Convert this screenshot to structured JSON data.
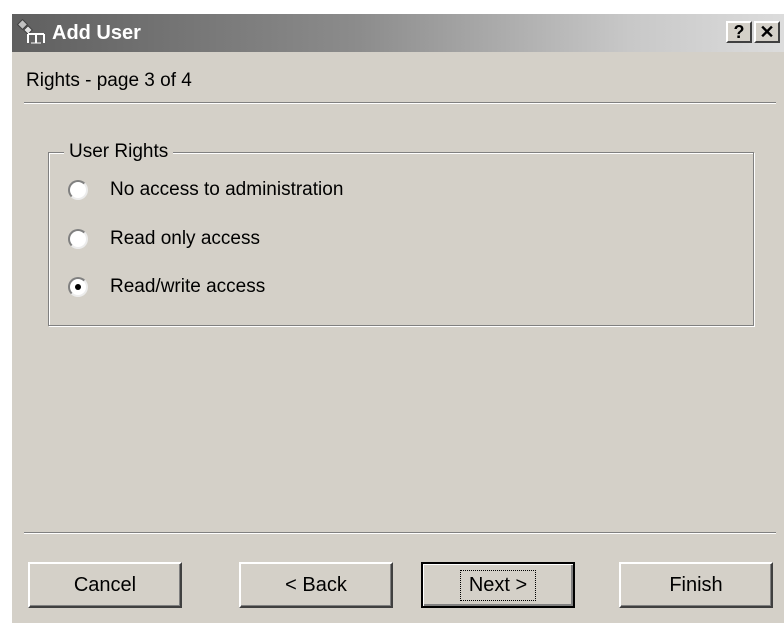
{
  "window": {
    "title": "Add User",
    "title_icon": "users-network-icon",
    "help_label": "?",
    "close_label": "✕"
  },
  "wizard": {
    "subtitle": "Rights - page 3 of 4"
  },
  "user_rights": {
    "legend": "User Rights",
    "options": [
      {
        "label": "No access to administration",
        "selected": false
      },
      {
        "label": "Read only access",
        "selected": false
      },
      {
        "label": "Read/write access",
        "selected": true
      }
    ]
  },
  "buttons": {
    "cancel": "Cancel",
    "back": "< Back",
    "next": "Next >",
    "finish": "Finish"
  },
  "colors": {
    "dialog_face": "#d4d0c8",
    "title_gradient_start": "#5f5f5f",
    "title_gradient_end": "#dcdcdc"
  }
}
